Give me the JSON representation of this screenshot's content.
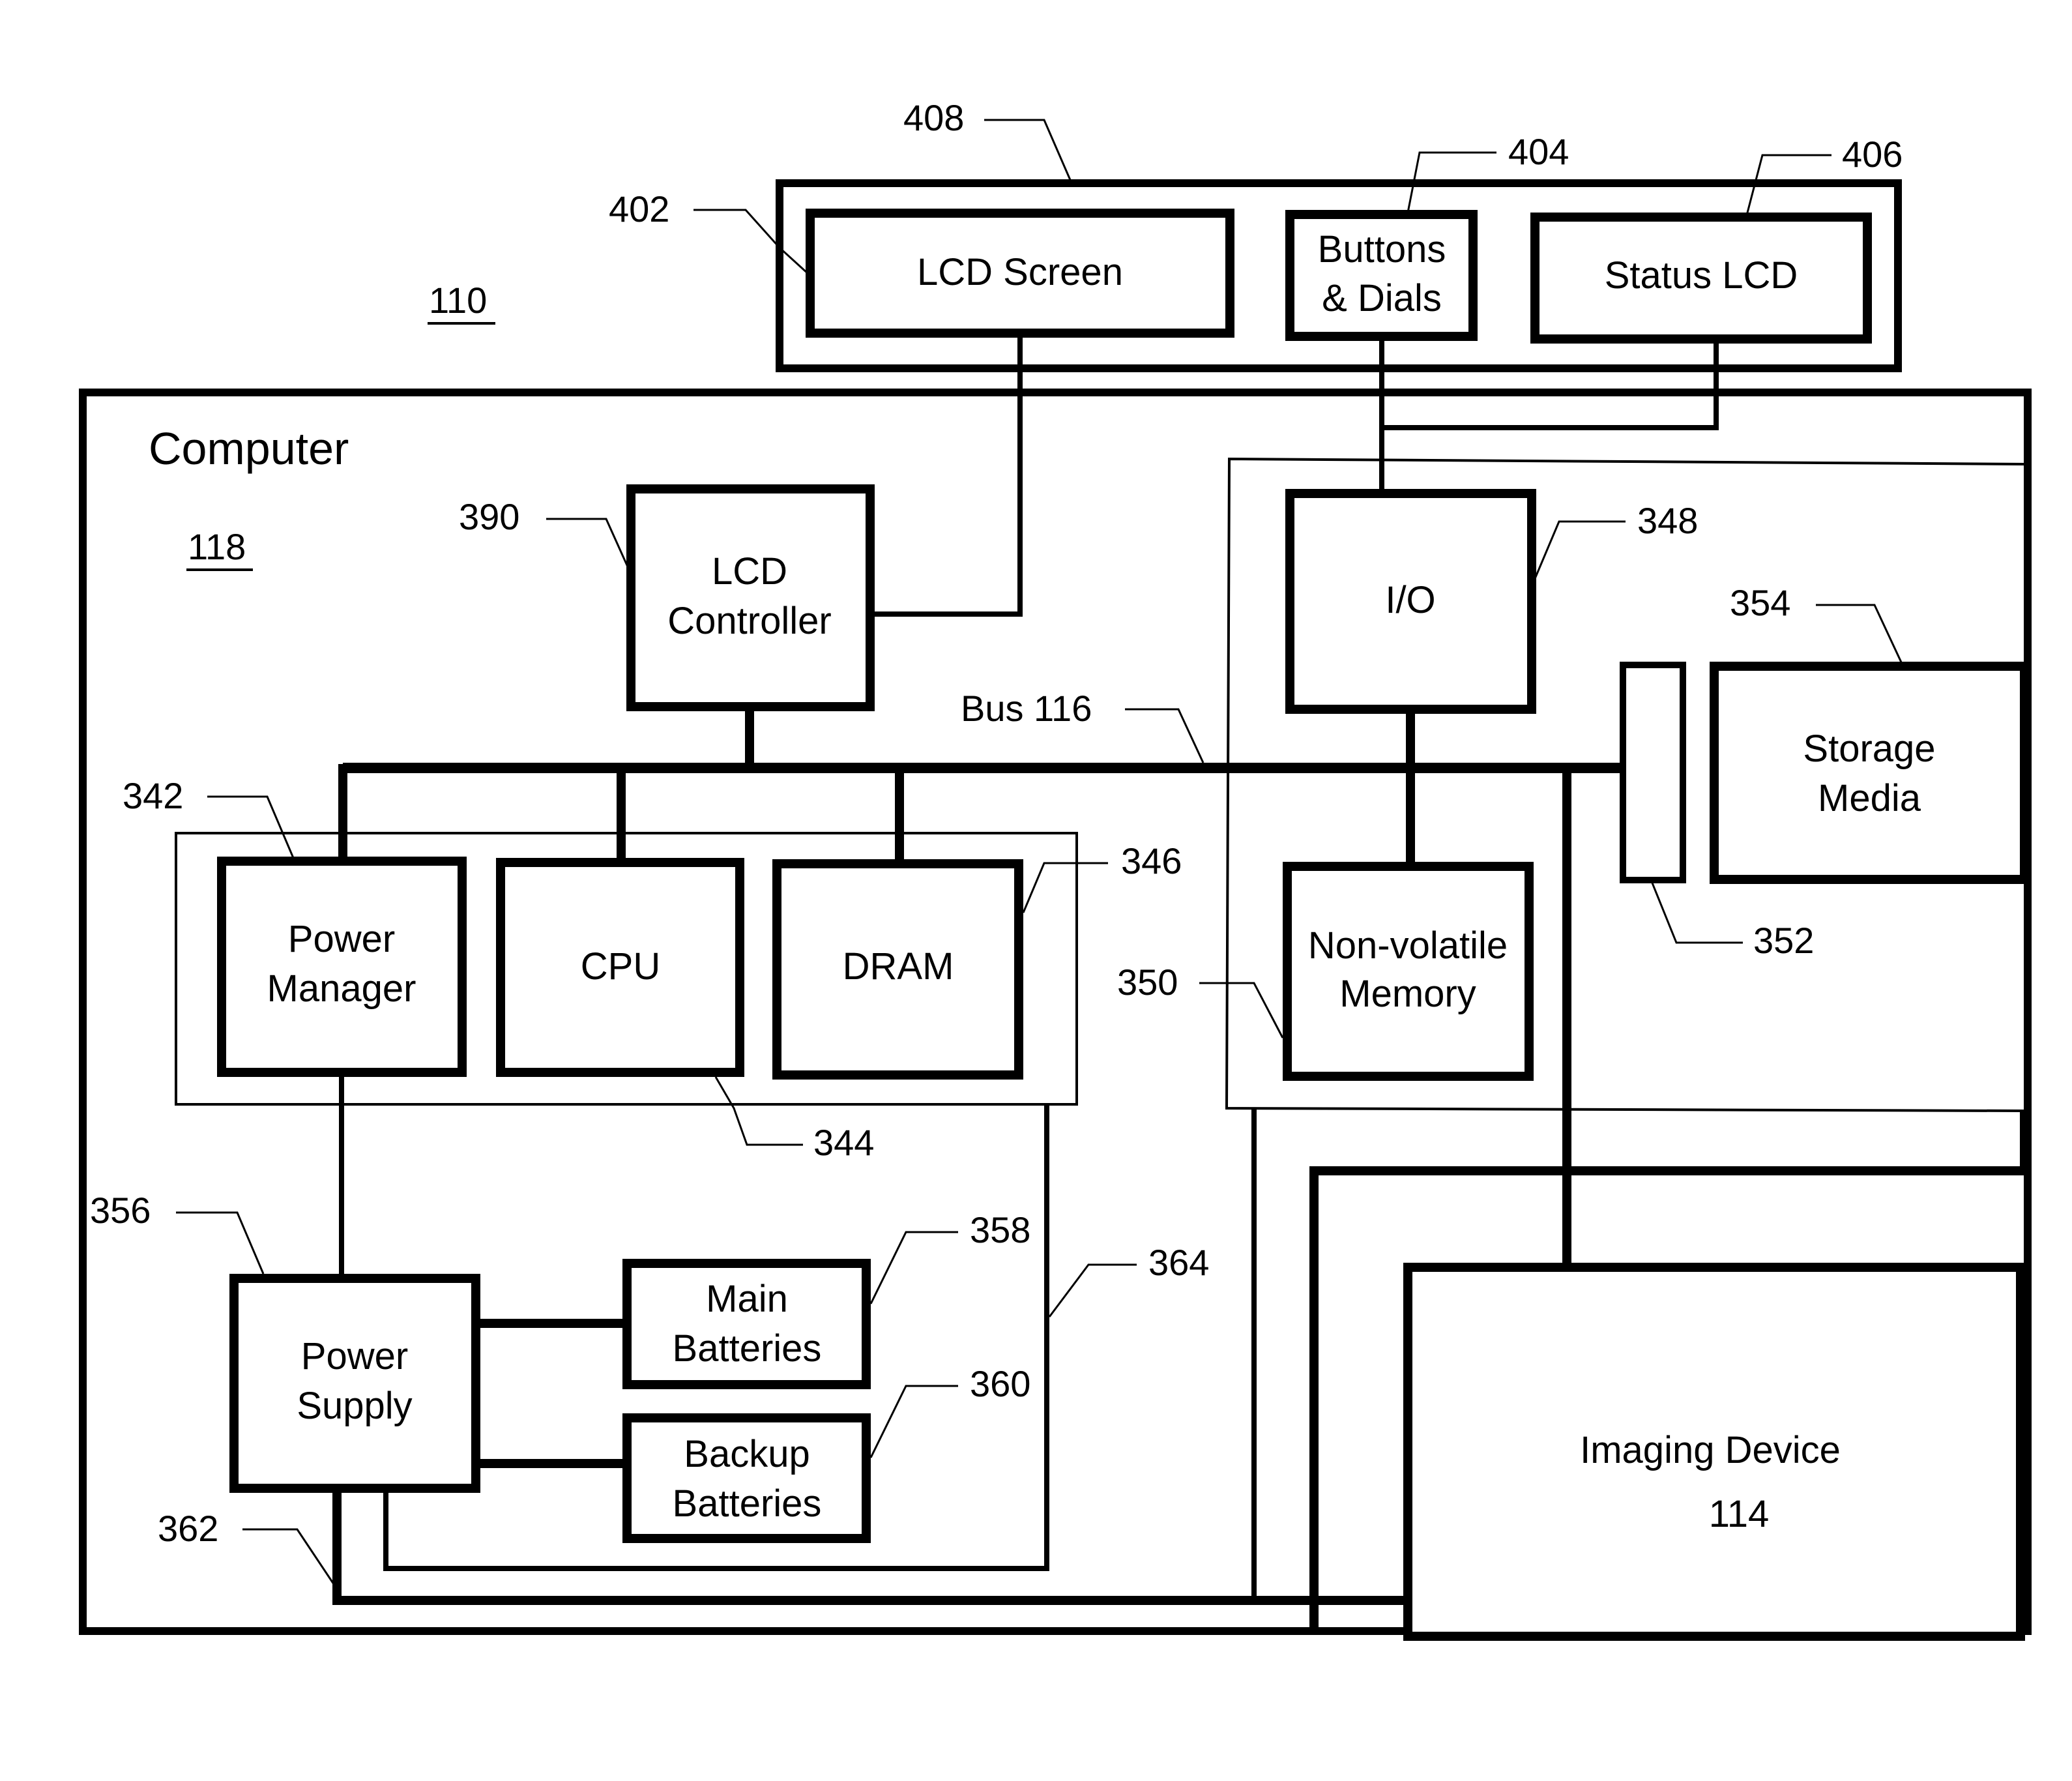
{
  "figure": {
    "system_ref": "110",
    "computer": {
      "title": "Computer",
      "ref": "118"
    },
    "bus": {
      "label": "Bus 116"
    },
    "user_interface_panel": {
      "ref": "408"
    },
    "blocks": {
      "lcd_screen": {
        "lines": [
          "LCD Screen"
        ],
        "ref": "402"
      },
      "buttons_dials": {
        "lines": [
          "Buttons",
          "& Dials"
        ],
        "ref": "404"
      },
      "status_lcd": {
        "lines": [
          "Status LCD"
        ],
        "ref": "406"
      },
      "lcd_controller": {
        "lines": [
          "LCD",
          "Controller"
        ],
        "ref": "390"
      },
      "io": {
        "lines": [
          "I/O"
        ],
        "ref": "348"
      },
      "storage_media": {
        "lines": [
          "Storage",
          "Media"
        ],
        "ref": "354"
      },
      "connector": {
        "ref": "352"
      },
      "power_manager": {
        "lines": [
          "Power",
          "Manager"
        ],
        "ref": "342"
      },
      "cpu": {
        "lines": [
          "CPU"
        ]
      },
      "dram": {
        "lines": [
          "DRAM"
        ],
        "ref": "346"
      },
      "nonvolatile_memory": {
        "lines": [
          "Non-volatile",
          "Memory"
        ],
        "ref": "350"
      },
      "power_supply": {
        "lines": [
          "Power",
          "Supply"
        ],
        "ref": "356"
      },
      "main_batteries": {
        "lines": [
          "Main",
          "Batteries"
        ],
        "ref": "358"
      },
      "backup_batteries": {
        "lines": [
          "Backup",
          "Batteries"
        ],
        "ref": "360"
      },
      "imaging_device": {
        "lines": [
          "Imaging Device",
          "114"
        ]
      }
    },
    "groups": {
      "processor_group": {
        "ref": "344"
      }
    },
    "wires": {
      "power_line_a": {
        "ref": "362"
      },
      "power_line_b": {
        "ref": "364"
      }
    }
  }
}
